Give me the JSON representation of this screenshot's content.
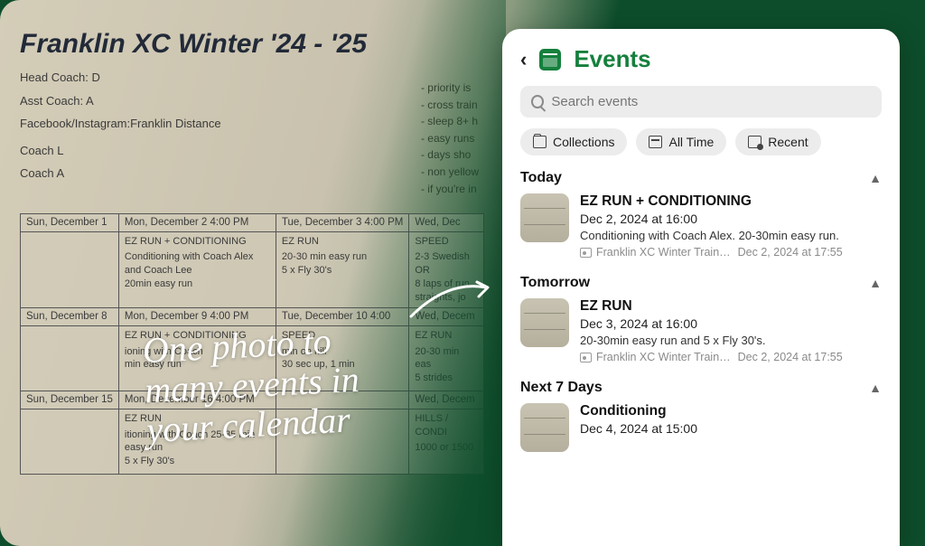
{
  "paper": {
    "title": "Franklin XC Winter '24 - '25",
    "meta": {
      "head_coach": "Head Coach: D",
      "asst_coach": "Asst Coach: A",
      "social": "Facebook/Instagram:Franklin Distance",
      "coach_l": "Coach L",
      "coach_a": "Coach A"
    },
    "notes": {
      "l1": "- priority is",
      "l2": "- cross train",
      "l3": "- sleep 8+ h",
      "l4": "- easy runs",
      "l5": "- days sho",
      "l6": "- non yellow",
      "l7": "- if you're in"
    },
    "weeks": [
      {
        "headers": [
          "Sun, December 1",
          "Mon, December 2  4:00 PM",
          "Tue, December 3  4:00 PM",
          "Wed, Dec"
        ],
        "cells": [
          {
            "title": "",
            "body": ""
          },
          {
            "title": "EZ RUN + CONDITIONING",
            "body": "Conditioning with Coach Alex\nand Coach Lee\n20min easy run"
          },
          {
            "title": "EZ RUN",
            "body": "20-30 min easy run\n5 x Fly 30's"
          },
          {
            "title": "SPEED",
            "body": "2-3 Swedish\nOR\n8 laps of run\nstraights, jo"
          }
        ]
      },
      {
        "headers": [
          "Sun, December 8",
          "Mon, December 9  4:00 PM",
          "Tue, December 10  4:00",
          "Wed, Decem"
        ],
        "cells": [
          {
            "title": "",
            "body": ""
          },
          {
            "title": "EZ RUN + CONDITIONING",
            "body": "ioning with Coach\nmin easy run"
          },
          {
            "title": "SPEED",
            "body": "min on hill\n30 sec up, 1 min"
          },
          {
            "title": "EZ RUN",
            "body": "20-30 min eas\n5 strides"
          }
        ]
      },
      {
        "headers": [
          "Sun, December 15",
          "Mon, December 16  4:00 PM",
          "",
          "Wed, Decem"
        ],
        "cells": [
          {
            "title": "",
            "body": ""
          },
          {
            "title": "EZ RUN",
            "body": "itioning with Coach   25-35 min easy run\n5 x Fly 30's"
          },
          {
            "title": "",
            "body": ""
          },
          {
            "title": "HILLS / CONDI",
            "body": "1000 or 1500"
          }
        ]
      }
    ]
  },
  "overlay": {
    "handwriting": "One photo to\nmany events in\nyour calendar"
  },
  "app": {
    "title": "Events",
    "search_placeholder": "Search events",
    "chips": {
      "collections": "Collections",
      "all_time": "All Time",
      "recent": "Recent"
    },
    "sections": {
      "today": {
        "label": "Today",
        "event": {
          "name": "EZ RUN + CONDITIONING",
          "date": "Dec 2, 2024 at 16:00",
          "desc": "Conditioning with Coach Alex. 20-30min easy run.",
          "source": "Franklin XC Winter Train…",
          "timestamp": "Dec 2, 2024 at 17:55"
        }
      },
      "tomorrow": {
        "label": "Tomorrow",
        "event": {
          "name": "EZ RUN",
          "date": "Dec 3, 2024 at 16:00",
          "desc": "20-30min easy run and 5 x Fly 30's.",
          "source": "Franklin XC Winter Train…",
          "timestamp": "Dec 2, 2024 at 17:55"
        }
      },
      "next7": {
        "label": "Next 7 Days",
        "event": {
          "name": "Conditioning",
          "date": "Dec 4, 2024 at 15:00",
          "desc": ""
        }
      }
    }
  }
}
